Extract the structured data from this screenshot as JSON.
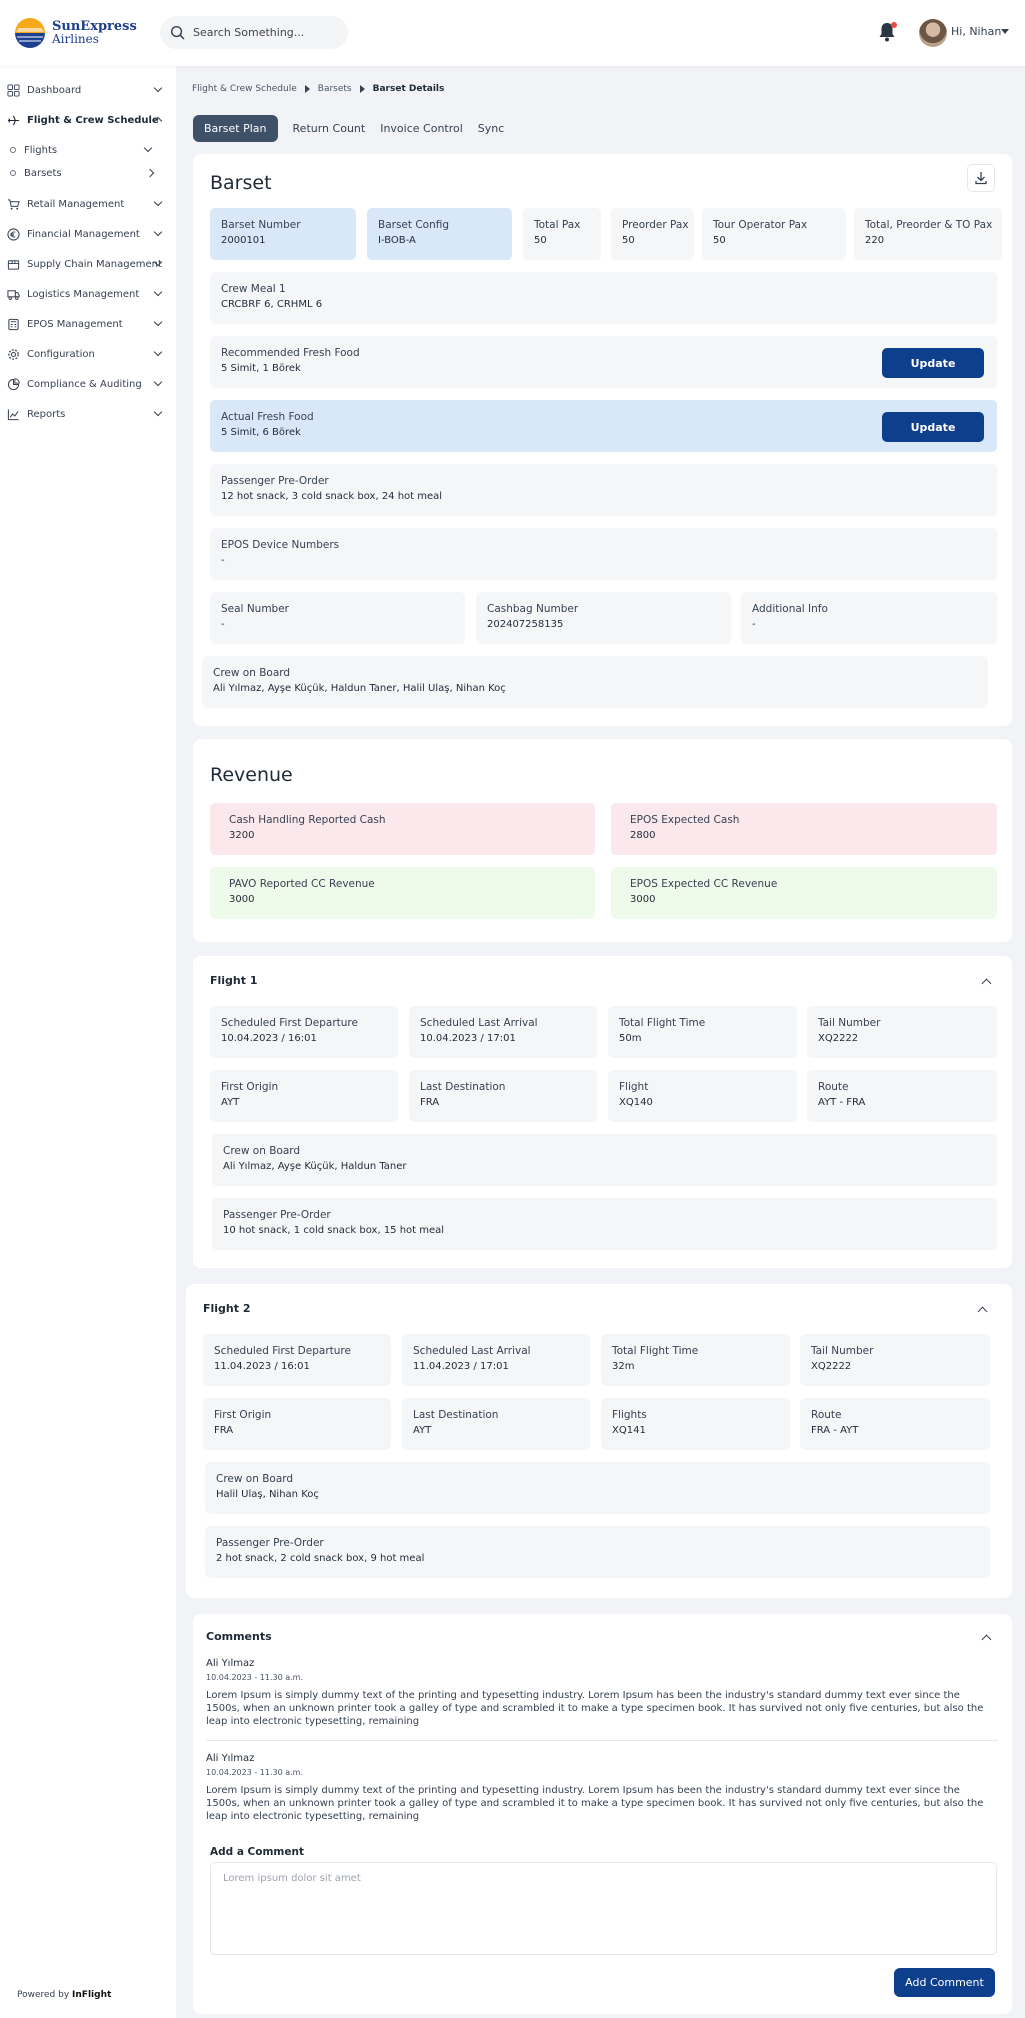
{
  "header": {
    "logo_line1": "SunExpress",
    "logo_line2": "Airlines",
    "search_placeholder": "Search Something...",
    "greeting": "Hi, Nihan"
  },
  "sidebar": {
    "items": [
      {
        "label": "Dashboard",
        "icon": "grid-icon"
      },
      {
        "label": "Flight & Crew Schedule",
        "icon": "plane-icon"
      },
      {
        "label": "Flights",
        "icon": "dot-icon"
      },
      {
        "label": "Barsets",
        "icon": "dot-icon"
      },
      {
        "label": "Retail Management",
        "icon": "cart-icon"
      },
      {
        "label": "Financial Management",
        "icon": "euro-icon"
      },
      {
        "label": "Supply Chain Management",
        "icon": "box-icon"
      },
      {
        "label": "Logistics Management",
        "icon": "truck-icon"
      },
      {
        "label": "EPOS Management",
        "icon": "pos-icon"
      },
      {
        "label": "Configuration",
        "icon": "gear-icon"
      },
      {
        "label": "Compliance & Auditing",
        "icon": "pie-icon"
      },
      {
        "label": "Reports",
        "icon": "chart-icon"
      }
    ],
    "powered_prefix": "Powered by",
    "powered_brand": "InFlight"
  },
  "breadcrumb": [
    "Flight & Crew Schedule",
    "Barsets",
    "Barset Details"
  ],
  "tabs": [
    "Barset Plan",
    "Return Count",
    "Invoice Control",
    "Sync"
  ],
  "barset": {
    "title": "Barset",
    "barset_number": {
      "label": "Barset Number",
      "value": "2000101"
    },
    "barset_config": {
      "label": "Barset Config",
      "value": "I-BOB-A"
    },
    "total_pax": {
      "label": "Total Pax",
      "value": "50"
    },
    "preorder_pax": {
      "label": "Preorder Pax",
      "value": "50"
    },
    "tour_operator_pax": {
      "label": "Tour Operator Pax",
      "value": "50"
    },
    "total_preorder_to_pax": {
      "label": "Total, Preorder & TO Pax",
      "value": "220"
    },
    "crew_meal": {
      "label": "Crew Meal 1",
      "value": "CRCBRF 6, CRHML 6"
    },
    "recommended_fresh_food": {
      "label": "Recommended Fresh Food",
      "value": "5 Simit, 1 Börek"
    },
    "actual_fresh_food": {
      "label": "Actual Fresh Food",
      "value": "5 Simit, 6 Börek"
    },
    "update_label": "Update",
    "passenger_preorder": {
      "label": "Passenger Pre-Order",
      "value": "12 hot snack, 3 cold snack box, 24 hot meal"
    },
    "epos_device_numbers": {
      "label": "EPOS Device Numbers",
      "value": "-"
    },
    "seal_number": {
      "label": "Seal Number",
      "value": "-"
    },
    "cashbag_number": {
      "label": "Cashbag Number",
      "value": "202407258135"
    },
    "additional_info": {
      "label": "Additional Info",
      "value": "-"
    },
    "crew_on_board": {
      "label": "Crew on Board",
      "value": "Ali Yılmaz, Ayşe Küçük, Haldun Taner, Halil Ulaş, Nihan Koç"
    }
  },
  "revenue": {
    "title": "Revenue",
    "cash_handling_reported_cash": {
      "label": "Cash Handling Reported Cash",
      "value": "3200"
    },
    "epos_expected_cash": {
      "label": "EPOS Expected Cash",
      "value": "2800"
    },
    "pavo_reported_cc_revenue": {
      "label": "PAVO Reported CC Revenue",
      "value": "3000"
    },
    "epos_expected_cc_revenue": {
      "label": "EPOS Expected CC Revenue",
      "value": "3000"
    }
  },
  "flight1": {
    "title": "Flight 1",
    "scheduled_first_departure": {
      "label": "Scheduled First Departure",
      "value": "10.04.2023 / 16:01"
    },
    "scheduled_last_arrival": {
      "label": "Scheduled Last Arrival",
      "value": "10.04.2023 / 17:01"
    },
    "total_flight_time": {
      "label": "Total Flight Time",
      "value": "50m"
    },
    "tail_number": {
      "label": "Tail Number",
      "value": "XQ2222"
    },
    "first_origin": {
      "label": "First Origin",
      "value": "AYT"
    },
    "last_destination": {
      "label": "Last Destination",
      "value": "FRA"
    },
    "flight": {
      "label": "Flight",
      "value": "XQ140"
    },
    "route": {
      "label": "Route",
      "value": "AYT - FRA"
    },
    "crew_on_board": {
      "label": "Crew on Board",
      "value": "Ali Yılmaz, Ayşe Küçük, Haldun Taner"
    },
    "passenger_preorder": {
      "label": "Passenger Pre-Order",
      "value": "10 hot snack, 1 cold snack box, 15 hot meal"
    }
  },
  "flight2": {
    "title": "Flight 2",
    "scheduled_first_departure": {
      "label": "Scheduled First Departure",
      "value": "11.04.2023 / 16:01"
    },
    "scheduled_last_arrival": {
      "label": "Scheduled Last Arrival",
      "value": "11.04.2023 / 17:01"
    },
    "total_flight_time": {
      "label": "Total Flight Time",
      "value": "32m"
    },
    "tail_number": {
      "label": "Tail Number",
      "value": "XQ2222"
    },
    "first_origin": {
      "label": "First Origin",
      "value": "FRA"
    },
    "last_destination": {
      "label": "Last Destination",
      "value": "AYT"
    },
    "flight": {
      "label": "Flights",
      "value": "XQ141"
    },
    "route": {
      "label": "Route",
      "value": "FRA - AYT"
    },
    "crew_on_board": {
      "label": "Crew on Board",
      "value": "Halil Ulaş, Nihan Koç"
    },
    "passenger_preorder": {
      "label": "Passenger Pre-Order",
      "value": "2 hot snack, 2 cold snack box, 9 hot meal"
    }
  },
  "comments": {
    "title": "Comments",
    "items": [
      {
        "author": "Ali Yılmaz",
        "date": "10.04.2023 - 11.30 a.m.",
        "text": "Lorem Ipsum is simply dummy text of the printing and typesetting industry. Lorem Ipsum has been the industry's standard dummy text ever since the 1500s, when an unknown printer took a galley of type and scrambled it to make a type specimen book. It has survived not only five centuries, but also the leap into electronic typesetting, remaining"
      },
      {
        "author": "Ali Yılmaz",
        "date": "10.04.2023 - 11.30 a.m.",
        "text": "Lorem Ipsum is simply dummy text of the printing and typesetting industry. Lorem Ipsum has been the industry's standard dummy text ever since the 1500s, when an unknown printer took a galley of type and scrambled it to make a type specimen book. It has survived not only five centuries, but also the leap into electronic typesetting, remaining"
      }
    ],
    "add_title": "Add a Comment",
    "placeholder": "Lorem ipsum dolor sit amet",
    "add_button": "Add Comment"
  },
  "colors": {
    "brand": "#0e3f8c",
    "active_tab": "#3e5169",
    "highlight_blue": "#d9e8f8",
    "alert_pink": "#fbe8ec",
    "ok_green": "#eefbea"
  }
}
